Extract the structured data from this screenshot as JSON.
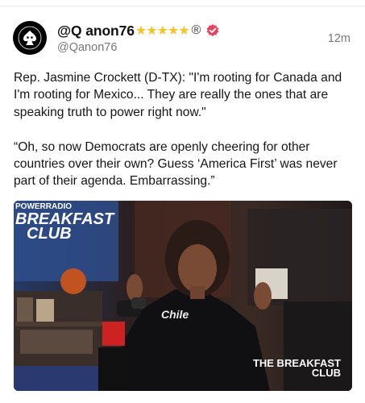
{
  "author": {
    "display_name": "@Q anon76",
    "badge_stars": "★★★★★",
    "badge_registered": "®",
    "handle": "@Qanon76",
    "avatar_icon": "spade-pirate-icon",
    "verified_icon": "verified-badge-icon"
  },
  "post": {
    "timestamp": "12m",
    "paragraph_1": "Rep. Jasmine Crockett (D-TX): \"I'm rooting for Canada and I'm rooting for Mexico... They are really the ones that are speaking truth to power right now.\"",
    "paragraph_2": "“Oh, so now Democrats are openly cheering for other countries over their own? Guess ‘America First’ was never part of their agenda. Embarrassing.”"
  },
  "media": {
    "logo_top_prefix": "POWER",
    "logo_top_suffix": "RADIO",
    "logo_main_1": "BREAKFAST",
    "logo_main_2": "CLUB",
    "watermark_1": "THE BREAKFAST",
    "watermark_2": "CLUB",
    "hoodie_text": "Chile"
  },
  "colors": {
    "verified": "#e8425c",
    "stars": "#f4c32d",
    "secondary_text": "#777777"
  }
}
